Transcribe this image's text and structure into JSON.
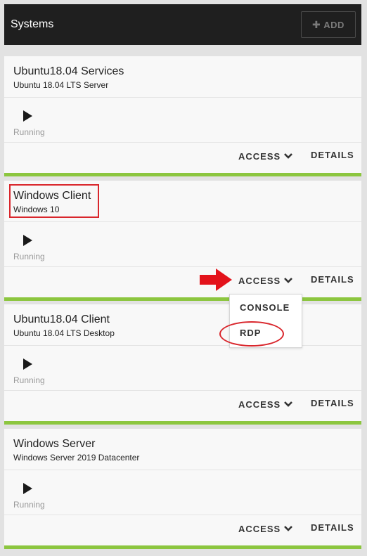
{
  "header": {
    "title": "Systems",
    "add_label": "ADD"
  },
  "systems": [
    {
      "name": "Ubuntu18.04 Services",
      "os": "Ubuntu 18.04 LTS Server",
      "status": "Running",
      "access_label": "ACCESS",
      "details_label": "DETAILS"
    },
    {
      "name": "Windows Client",
      "os": "Windows 10",
      "status": "Running",
      "access_label": "ACCESS",
      "details_label": "DETAILS"
    },
    {
      "name": "Ubuntu18.04 Client",
      "os": "Ubuntu 18.04 LTS Desktop",
      "status": "Running",
      "access_label": "ACCESS",
      "details_label": "DETAILS"
    },
    {
      "name": "Windows Server",
      "os": "Windows Server 2019 Datacenter",
      "status": "Running",
      "access_label": "ACCESS",
      "details_label": "DETAILS"
    }
  ],
  "access_menu": {
    "items": [
      "CONSOLE",
      "RDP"
    ]
  },
  "icons": {
    "add": "plus-icon",
    "start": "play-icon",
    "access": "chevron-down-icon"
  },
  "colors": {
    "header_bg": "#1f1f1f",
    "status_bar": "#8cc63f",
    "annotation": "#d9262c"
  }
}
